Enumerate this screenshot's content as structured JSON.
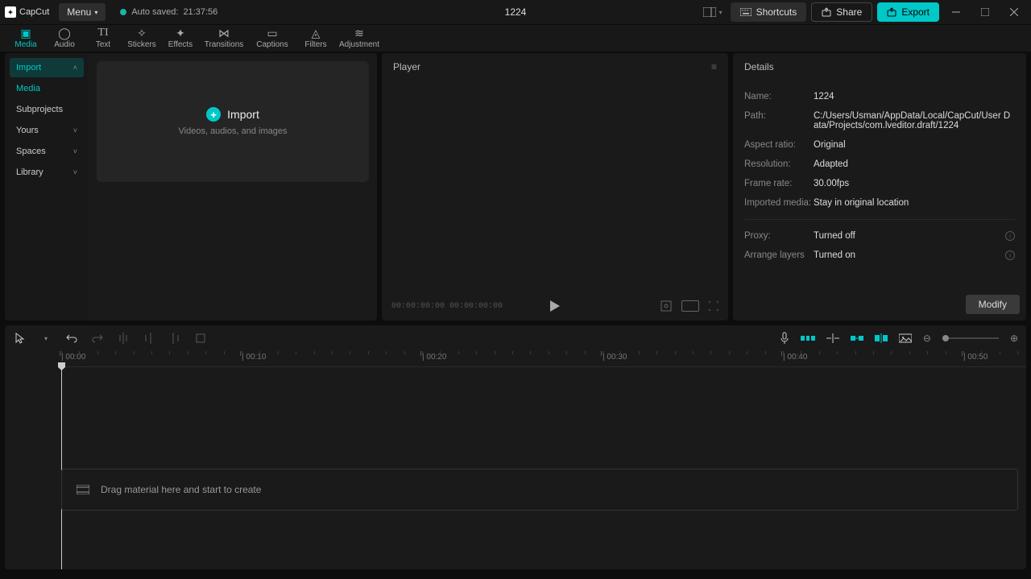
{
  "app": {
    "name": "CapCut"
  },
  "titlebar": {
    "menu": "Menu",
    "autosave_prefix": "Auto saved:",
    "autosave_time": "21:37:56",
    "project_title": "1224",
    "shortcuts": "Shortcuts",
    "share": "Share",
    "export": "Export"
  },
  "toptabs": {
    "media": "Media",
    "audio": "Audio",
    "text": "Text",
    "stickers": "Stickers",
    "effects": "Effects",
    "transitions": "Transitions",
    "captions": "Captions",
    "filters": "Filters",
    "adjustment": "Adjustment"
  },
  "sidebar": {
    "import": "Import",
    "media": "Media",
    "subprojects": "Subprojects",
    "yours": "Yours",
    "spaces": "Spaces",
    "library": "Library"
  },
  "import_box": {
    "title": "Import",
    "subtitle": "Videos, audios, and images"
  },
  "player": {
    "title": "Player",
    "time_current": "00:00:00:00",
    "time_total": "00:00:00:00"
  },
  "details": {
    "title": "Details",
    "labels": {
      "name": "Name:",
      "path": "Path:",
      "aspect": "Aspect ratio:",
      "resolution": "Resolution:",
      "framerate": "Frame rate:",
      "imported": "Imported media:",
      "proxy": "Proxy:",
      "arrange": "Arrange layers"
    },
    "values": {
      "name": "1224",
      "path": "C:/Users/Usman/AppData/Local/CapCut/User Data/Projects/com.lveditor.draft/1224",
      "aspect": "Original",
      "resolution": "Adapted",
      "framerate": "30.00fps",
      "imported": "Stay in original location",
      "proxy": "Turned off",
      "arrange": "Turned on"
    },
    "modify": "Modify"
  },
  "timeline": {
    "ticks": [
      "00:00",
      "00:10",
      "00:20",
      "00:30",
      "00:40",
      "00:50"
    ],
    "drop_hint": "Drag material here and start to create"
  }
}
